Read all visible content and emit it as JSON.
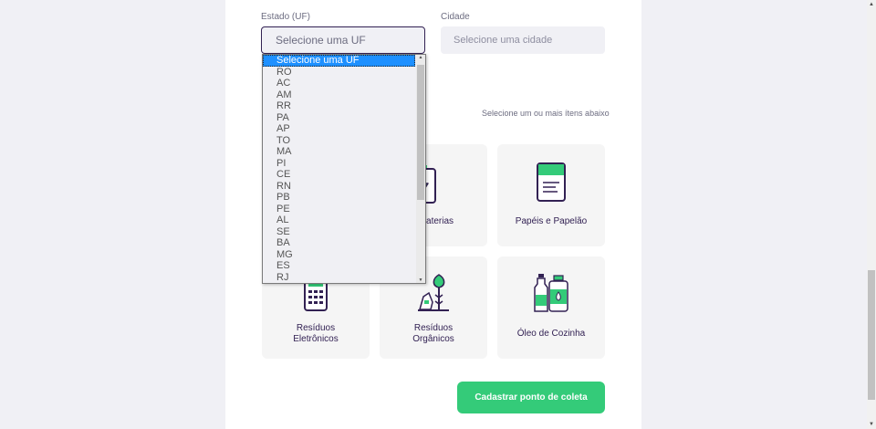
{
  "form": {
    "uf_label": "Estado (UF)",
    "city_label": "Cidade",
    "uf_value": "Selecione uma UF",
    "city_value": "Selecione uma cidade",
    "items_hint": "Selecione um ou mais ítens abaixo",
    "submit_label": "Cadastrar ponto de coleta"
  },
  "uf_options": [
    "Selecione uma UF",
    "RO",
    "AC",
    "AM",
    "RR",
    "PA",
    "AP",
    "TO",
    "MA",
    "PI",
    "CE",
    "RN",
    "PB",
    "PE",
    "AL",
    "SE",
    "BA",
    "MG",
    "ES",
    "RJ"
  ],
  "items": {
    "baterias": "e Baterias",
    "papeis": "Papéis e Papelão",
    "eletronicos_1": "Resíduos",
    "eletronicos_2": "Eletrônicos",
    "organicos_1": "Resíduos",
    "organicos_2": "Orgânicos",
    "oleo": "Óleo de Cozinha"
  },
  "colors": {
    "accent": "#34cb79",
    "title": "#322153",
    "text": "#6c6c80",
    "field_bg": "#f0f0f5"
  }
}
